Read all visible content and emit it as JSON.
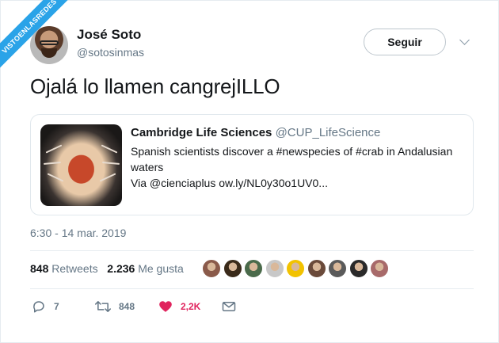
{
  "watermark": "VISTOENLASREDES",
  "author": {
    "name": "José Soto",
    "handle": "@sotosinmas"
  },
  "follow_label": "Seguir",
  "tweet_text": "Ojalá lo llamen cangrejILLO",
  "card": {
    "name": "Cambridge Life Sciences",
    "handle": "@CUP_LifeScience",
    "lines": [
      "Spanish scientists discover a #newspecies of #crab in Andalusian",
      "waters",
      "Via @cienciaplus ow.ly/NL0y30o1UV0..."
    ]
  },
  "timestamp": "6:30 - 14 mar. 2019",
  "stats": {
    "retweets_count": "848",
    "retweets_label": "Retweets",
    "likes_count": "2.236",
    "likes_label": "Me gusta"
  },
  "liker_avatars": [
    "#8a5a4a",
    "#3a2a1a",
    "#4a6a4a",
    "#c8c8c8",
    "#f2c200",
    "#6a4a3a",
    "#5a5a5a",
    "#2a2a2a",
    "#a86a6a"
  ],
  "actions": {
    "reply_count": "7",
    "retweet_count": "848",
    "like_count": "2,2K"
  },
  "colors": {
    "like": "#e0245e",
    "meta": "#657786",
    "watermark": "#2aa3e8"
  },
  "icons": [
    "reply-icon",
    "retweet-icon",
    "heart-icon",
    "message-icon",
    "chevron-down-icon"
  ]
}
